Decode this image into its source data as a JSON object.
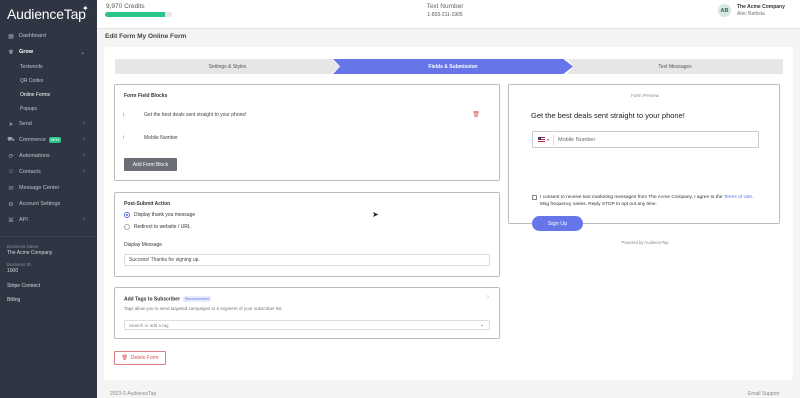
{
  "app": {
    "logo": "AudienceTap"
  },
  "topbar": {
    "credits": "9,970 Credits",
    "credits_fraction": 0.9,
    "text_number_label": "Text Number",
    "text_number": "1-833-211-1905",
    "avatar_initials": "AB",
    "company": "The Acme Company",
    "user": "Alec Battista"
  },
  "sidebar": {
    "items": [
      {
        "label": "Dashboard",
        "icon": "grid-icon"
      },
      {
        "label": "Grow",
        "icon": "sprout-icon"
      },
      {
        "label": "Send",
        "icon": "send-icon"
      },
      {
        "label": "Commerce",
        "icon": "cart-icon",
        "badge": "NEW"
      },
      {
        "label": "Automations",
        "icon": "automation-icon"
      },
      {
        "label": "Contacts",
        "icon": "contacts-icon"
      },
      {
        "label": "Message Center",
        "icon": "chat-icon"
      },
      {
        "label": "Account Settings",
        "icon": "gear-icon"
      },
      {
        "label": "API",
        "icon": "api-icon"
      }
    ],
    "sub_items": [
      "Textwords",
      "QR Codes",
      "Online Forms",
      "Popups"
    ],
    "business_name_label": "Business Name",
    "business_name": "The Acme Company",
    "business_id_label": "Business ID",
    "business_id": "1000",
    "stripe_connect": "Stripe Connect",
    "billing": "Billing"
  },
  "page": {
    "title": "Edit Form My Online Form"
  },
  "steps": [
    "Settings & Styles",
    "Fields & Submission",
    "Text Messages"
  ],
  "form_field_blocks": {
    "title": "Form Field Blocks",
    "fields": [
      "Get the best deals sent straight to your phone!",
      "Mobile Number"
    ],
    "add_button": "Add Form Block"
  },
  "post_submit": {
    "title": "Post-Submit Action",
    "options": [
      "Display thank you message",
      "Redirect to website / URL"
    ],
    "display_message_label": "Display Message",
    "display_message_value": "Success! Thanks for signing up."
  },
  "tags": {
    "title": "Add Tags to Subscriber",
    "badge": "Recommended",
    "description": "Tags allow you to send targeted campaigns to a segment of your subscriber list.",
    "placeholder": "Search or add a tag"
  },
  "delete_button": "Delete Form",
  "preview": {
    "header": "Form Preview",
    "title": "Get the best deals sent straight to your phone!",
    "phone_placeholder": "Mobile Number",
    "consent_text": "I consent to receive text marketing messages from The Acme Company. I agree to the",
    "terms_link": "Terms of Use",
    "consent_tail": ". Msg frequency varies. Reply STOP to opt out any time.",
    "signup_button": "Sign Up",
    "powered_by": "Powered by AudienceTap"
  },
  "footer": {
    "left": "2023 © AudienceTap",
    "right": "Email Support"
  }
}
